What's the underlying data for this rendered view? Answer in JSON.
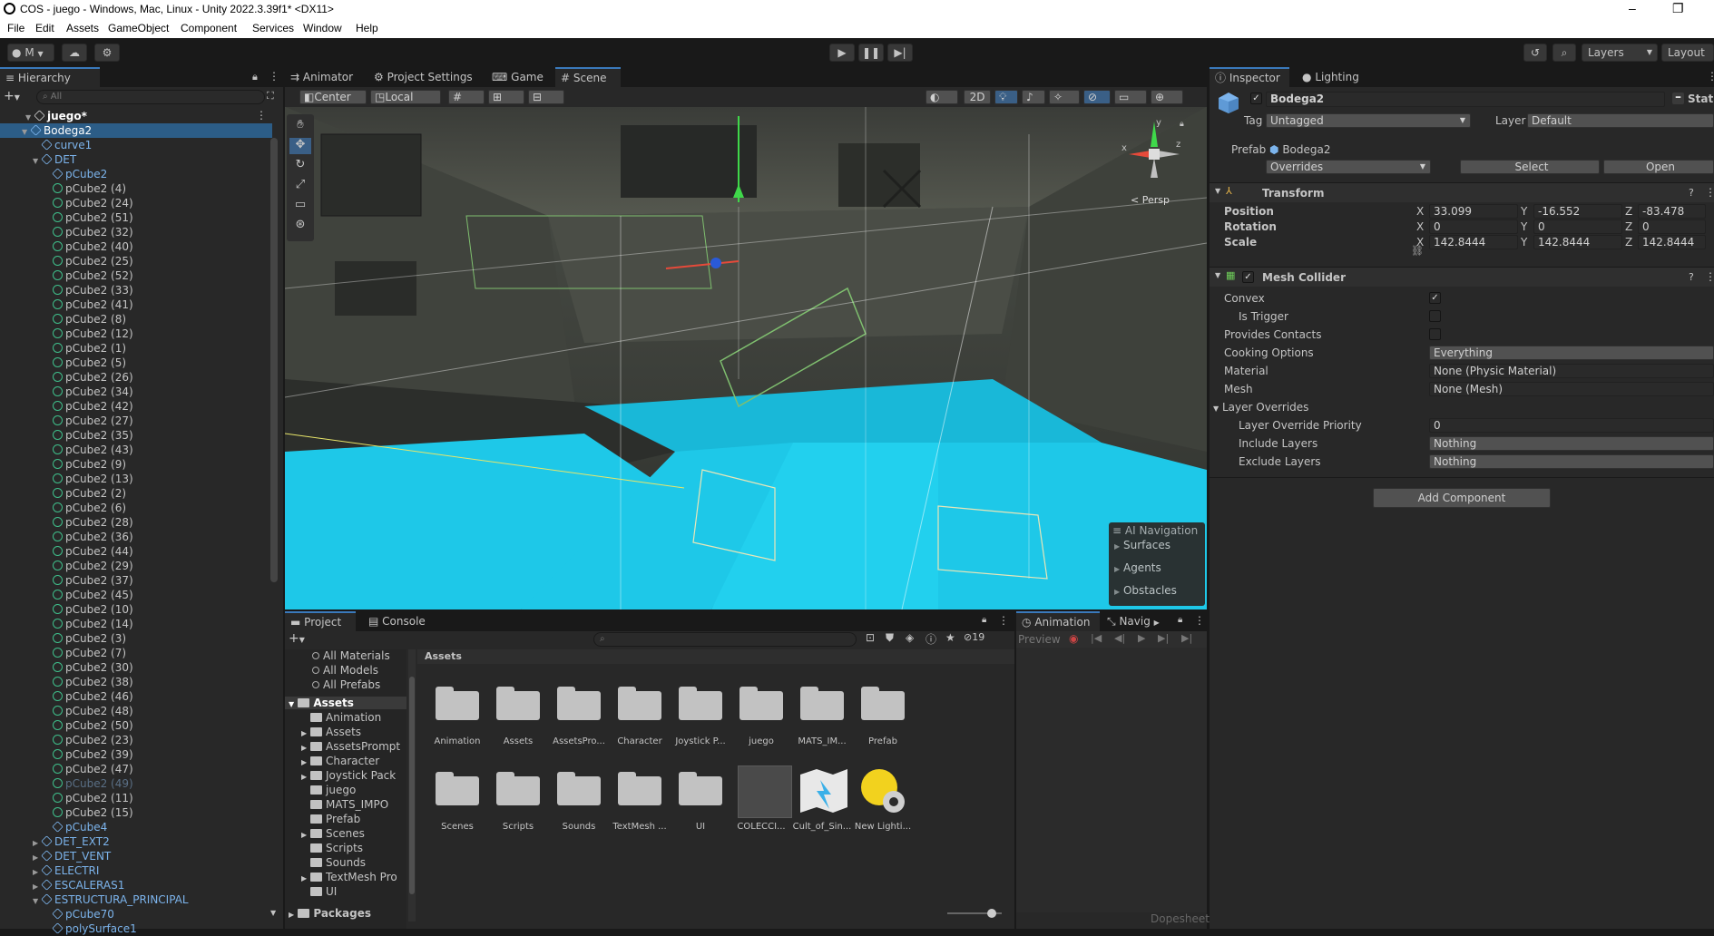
{
  "window": {
    "title": "COS - juego - Windows, Mac, Linux - Unity 2022.3.39f1* <DX11>",
    "controls": [
      "–",
      "❐"
    ]
  },
  "menu": [
    "File",
    "Edit",
    "Assets",
    "GameObject",
    "Component",
    "Services",
    "Window",
    "Help"
  ],
  "toolbar": {
    "account": "M",
    "layers": "Layers",
    "layout": "Layout"
  },
  "hierarchy": {
    "tab": "Hierarchy",
    "search_placeholder": "All",
    "scene": "juego*",
    "items": [
      {
        "label": "Bodega2",
        "indent": 2,
        "type": "prefab",
        "arrow": "▼",
        "selected": true
      },
      {
        "label": "curve1",
        "indent": 3,
        "type": "prefab"
      },
      {
        "label": "DET",
        "indent": 3,
        "type": "prefab",
        "arrow": "▼"
      },
      {
        "label": "pCube2",
        "indent": 4,
        "type": "prefab"
      },
      {
        "label": "pCube2 (4)",
        "indent": 4,
        "type": "white"
      },
      {
        "label": "pCube2 (24)",
        "indent": 4,
        "type": "white"
      },
      {
        "label": "pCube2 (51)",
        "indent": 4,
        "type": "white"
      },
      {
        "label": "pCube2 (32)",
        "indent": 4,
        "type": "white"
      },
      {
        "label": "pCube2 (40)",
        "indent": 4,
        "type": "white"
      },
      {
        "label": "pCube2 (25)",
        "indent": 4,
        "type": "white"
      },
      {
        "label": "pCube2 (52)",
        "indent": 4,
        "type": "white"
      },
      {
        "label": "pCube2 (33)",
        "indent": 4,
        "type": "white"
      },
      {
        "label": "pCube2 (41)",
        "indent": 4,
        "type": "white"
      },
      {
        "label": "pCube2 (8)",
        "indent": 4,
        "type": "white"
      },
      {
        "label": "pCube2 (12)",
        "indent": 4,
        "type": "white"
      },
      {
        "label": "pCube2 (1)",
        "indent": 4,
        "type": "white"
      },
      {
        "label": "pCube2 (5)",
        "indent": 4,
        "type": "white"
      },
      {
        "label": "pCube2 (26)",
        "indent": 4,
        "type": "white"
      },
      {
        "label": "pCube2 (34)",
        "indent": 4,
        "type": "white"
      },
      {
        "label": "pCube2 (42)",
        "indent": 4,
        "type": "white"
      },
      {
        "label": "pCube2 (27)",
        "indent": 4,
        "type": "white"
      },
      {
        "label": "pCube2 (35)",
        "indent": 4,
        "type": "white"
      },
      {
        "label": "pCube2 (43)",
        "indent": 4,
        "type": "white"
      },
      {
        "label": "pCube2 (9)",
        "indent": 4,
        "type": "white"
      },
      {
        "label": "pCube2 (13)",
        "indent": 4,
        "type": "white"
      },
      {
        "label": "pCube2 (2)",
        "indent": 4,
        "type": "white"
      },
      {
        "label": "pCube2 (6)",
        "indent": 4,
        "type": "white"
      },
      {
        "label": "pCube2 (28)",
        "indent": 4,
        "type": "white"
      },
      {
        "label": "pCube2 (36)",
        "indent": 4,
        "type": "white"
      },
      {
        "label": "pCube2 (44)",
        "indent": 4,
        "type": "white"
      },
      {
        "label": "pCube2 (29)",
        "indent": 4,
        "type": "white"
      },
      {
        "label": "pCube2 (37)",
        "indent": 4,
        "type": "white"
      },
      {
        "label": "pCube2 (45)",
        "indent": 4,
        "type": "white"
      },
      {
        "label": "pCube2 (10)",
        "indent": 4,
        "type": "white"
      },
      {
        "label": "pCube2 (14)",
        "indent": 4,
        "type": "white"
      },
      {
        "label": "pCube2 (3)",
        "indent": 4,
        "type": "white"
      },
      {
        "label": "pCube2 (7)",
        "indent": 4,
        "type": "white"
      },
      {
        "label": "pCube2 (30)",
        "indent": 4,
        "type": "white"
      },
      {
        "label": "pCube2 (38)",
        "indent": 4,
        "type": "white"
      },
      {
        "label": "pCube2 (46)",
        "indent": 4,
        "type": "white"
      },
      {
        "label": "pCube2 (48)",
        "indent": 4,
        "type": "white"
      },
      {
        "label": "pCube2 (50)",
        "indent": 4,
        "type": "white"
      },
      {
        "label": "pCube2 (23)",
        "indent": 4,
        "type": "white"
      },
      {
        "label": "pCube2 (39)",
        "indent": 4,
        "type": "white"
      },
      {
        "label": "pCube2 (47)",
        "indent": 4,
        "type": "white"
      },
      {
        "label": "pCube2 (49)",
        "indent": 4,
        "type": "dim"
      },
      {
        "label": "pCube2 (11)",
        "indent": 4,
        "type": "white"
      },
      {
        "label": "pCube2 (15)",
        "indent": 4,
        "type": "white"
      },
      {
        "label": "pCube4",
        "indent": 4,
        "type": "prefab"
      },
      {
        "label": "DET_EXT2",
        "indent": 3,
        "type": "prefab",
        "arrow": "▶"
      },
      {
        "label": "DET_VENT",
        "indent": 3,
        "type": "prefab",
        "arrow": "▶"
      },
      {
        "label": "ELECTRI",
        "indent": 3,
        "type": "prefab",
        "arrow": "▶"
      },
      {
        "label": "ESCALERAS1",
        "indent": 3,
        "type": "prefab",
        "arrow": "▶"
      },
      {
        "label": "ESTRUCTURA_PRINCIPAL",
        "indent": 3,
        "type": "prefab",
        "arrow": "▼"
      },
      {
        "label": "pCube70",
        "indent": 4,
        "type": "prefab"
      },
      {
        "label": "polySurface1",
        "indent": 4,
        "type": "prefab"
      }
    ]
  },
  "center_tabs": [
    "Animator",
    "Project Settings",
    "Game",
    "Scene"
  ],
  "scene": {
    "pivot": "Center",
    "space": "Local",
    "mode_2d": "2D",
    "persp": "< Persp",
    "gizmo_axes": {
      "x": "x",
      "y": "y",
      "z": "z"
    },
    "ai_navigation": {
      "title": "AI Navigation",
      "items": [
        "Surfaces",
        "Agents",
        "Obstacles"
      ]
    }
  },
  "inspector": {
    "tabs": [
      "Inspector",
      "Lighting"
    ],
    "object_name": "Bodega2",
    "static_label": "Stati",
    "tag_label": "Tag",
    "tag_value": "Untagged",
    "layer_label": "Layer",
    "layer_value": "Default",
    "prefab_label": "Prefab",
    "prefab_value": "Bodega2",
    "overrides": "Overrides",
    "select": "Select",
    "open": "Open",
    "transform": {
      "title": "Transform",
      "rows": [
        {
          "label": "Position",
          "x": "33.099",
          "y": "-16.552",
          "z": "-83.478"
        },
        {
          "label": "Rotation",
          "x": "0",
          "y": "0",
          "z": "0"
        },
        {
          "label": "Scale",
          "x": "142.8444",
          "y": "142.8444",
          "z": "142.8444"
        }
      ],
      "axis_labels": [
        "X",
        "Y",
        "Z"
      ]
    },
    "mesh_collider": {
      "title": "Mesh Collider",
      "convex": "Convex",
      "is_trigger": "Is Trigger",
      "provides_contacts": "Provides Contacts",
      "cooking_options": "Cooking Options",
      "cooking_value": "Everything",
      "material": "Material",
      "material_value": "None (Physic Material)",
      "mesh": "Mesh",
      "mesh_value": "None (Mesh)",
      "layer_overrides": "Layer Overrides",
      "override_priority": "Layer Override Priority",
      "override_priority_value": "0",
      "include_layers": "Include Layers",
      "include_value": "Nothing",
      "exclude_layers": "Exclude Layers",
      "exclude_value": "Nothing"
    },
    "add_component": "Add Component"
  },
  "project": {
    "tabs": [
      "Project",
      "Console"
    ],
    "search_placeholder": "",
    "hidden_count": "19",
    "favorites": [
      "All Materials",
      "All Models",
      "All Prefabs"
    ],
    "assets_root": "Assets",
    "tree": [
      "Animation",
      "Assets",
      "AssetsPrompt",
      "Character",
      "Joystick Pack",
      "juego",
      "MATS_IMPO",
      "Prefab",
      "Scenes",
      "Scripts",
      "Sounds",
      "TextMesh Pro",
      "UI"
    ],
    "packages": "Packages",
    "breadcrumb": "Assets",
    "grid_row1": [
      "Animation",
      "Assets",
      "AssetsPro...",
      "Character",
      "Joystick P...",
      "juego",
      "MATS_IM...",
      "Prefab"
    ],
    "grid_row2": [
      "Scenes",
      "Scripts",
      "Sounds",
      "TextMesh ...",
      "UI",
      "COLECCI...",
      "Cult_of_Sin...",
      "New Lighti..."
    ]
  },
  "animation": {
    "tabs": [
      "Animation",
      "Navig"
    ],
    "preview": "Preview",
    "dopesheet": "Dopesheet"
  },
  "colors": {
    "accent": "#3a79bb",
    "prefab_blue": "#7cb4ec",
    "cyan": "#1ec8e8",
    "panel": "#282828",
    "dark": "#191919"
  }
}
